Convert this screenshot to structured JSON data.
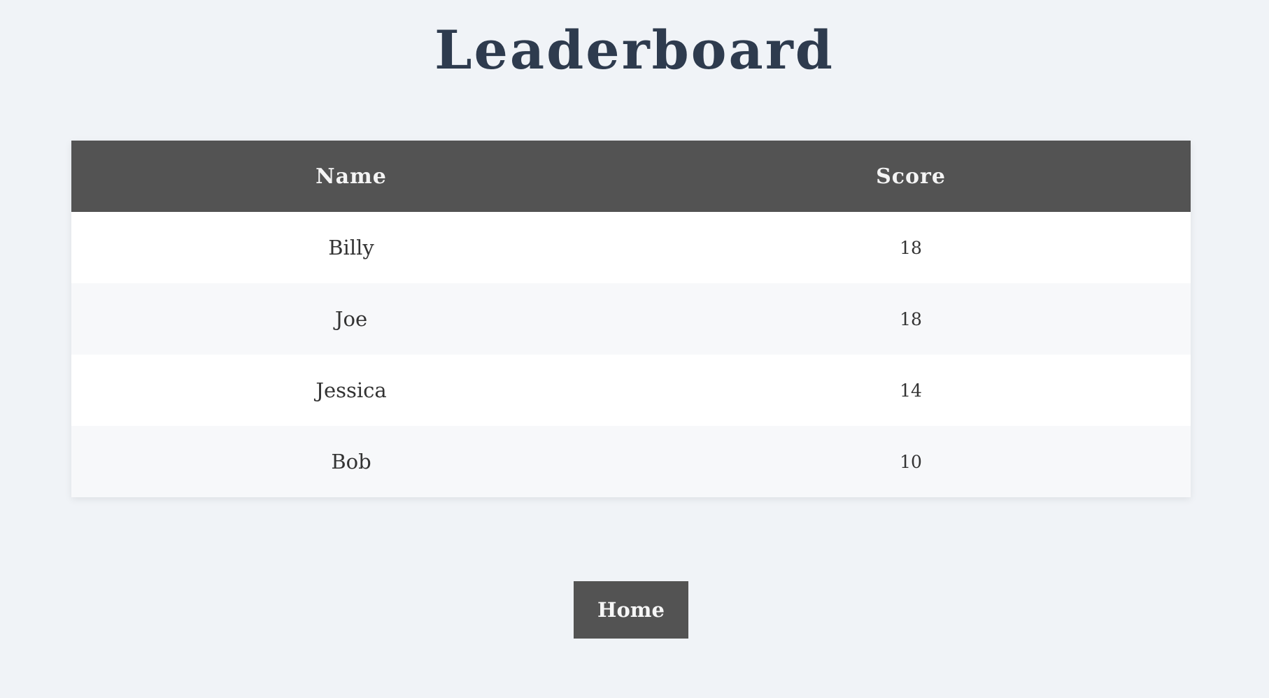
{
  "page": {
    "title": "Leaderboard"
  },
  "table": {
    "headers": {
      "name": "Name",
      "score": "Score"
    },
    "rows": [
      {
        "name": "Billy",
        "score": "18"
      },
      {
        "name": "Joe",
        "score": "18"
      },
      {
        "name": "Jessica",
        "score": "14"
      },
      {
        "name": "Bob",
        "score": "10"
      }
    ]
  },
  "actions": {
    "home_label": "Home"
  },
  "colors": {
    "background": "#f0f3f7",
    "header_background": "#535353",
    "button_background": "#535353",
    "title_text": "#2e3b4e"
  }
}
